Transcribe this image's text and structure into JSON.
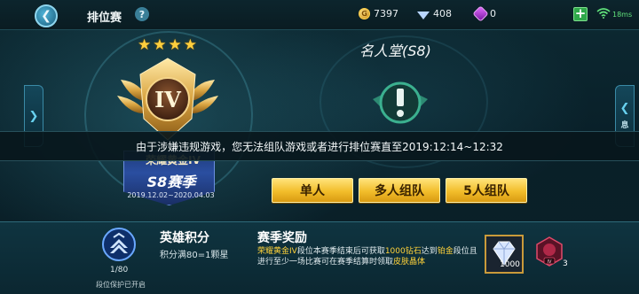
{
  "header": {
    "title": "排位赛",
    "help_icon": "?",
    "currencies": [
      {
        "icon": "gold-coin-icon",
        "value": "7397"
      },
      {
        "icon": "diamond-icon",
        "value": "408"
      },
      {
        "icon": "purple-gem-icon",
        "value": "0"
      }
    ],
    "ping": "18ms"
  },
  "rank": {
    "stars": 4,
    "tier_numeral": "IV",
    "rank_name": "荣耀黄金IV",
    "season": "S8赛季",
    "season_dates": "2019.12.02~2020.04.03"
  },
  "hall_of_fame": {
    "title": "名人堂(S8)"
  },
  "side_tab_right_text": "息",
  "banner": {
    "text": "由于涉嫌违规游戏，您无法组队游戏或者进行排位赛直至2019:12:14~12:32"
  },
  "modes": [
    {
      "label": "单人"
    },
    {
      "label": "多人组队"
    },
    {
      "label": "5人组队"
    }
  ],
  "hero_points": {
    "title": "英雄积分",
    "subtitle": "积分满80=1颗星",
    "progress": "1/80",
    "protect": "段位保护已开启"
  },
  "season_reward": {
    "title": "赛季奖励",
    "desc_parts": {
      "p1": "荣耀黄金IV",
      "p2": "段位本赛季结束后可获取",
      "p3": "1000钻石",
      "p4": "达到",
      "p5": "铂金",
      "p6": "段位且进行至少一场比赛可在赛季结算时领取",
      "p7": "皮肤晶体"
    },
    "item1_count": "1000",
    "item2_count": "3",
    "item2_badge": "IV"
  },
  "colors": {
    "accent_gold": "#f2bd2a",
    "highlight_yellow": "#ffd23a",
    "background": "#071a22"
  }
}
